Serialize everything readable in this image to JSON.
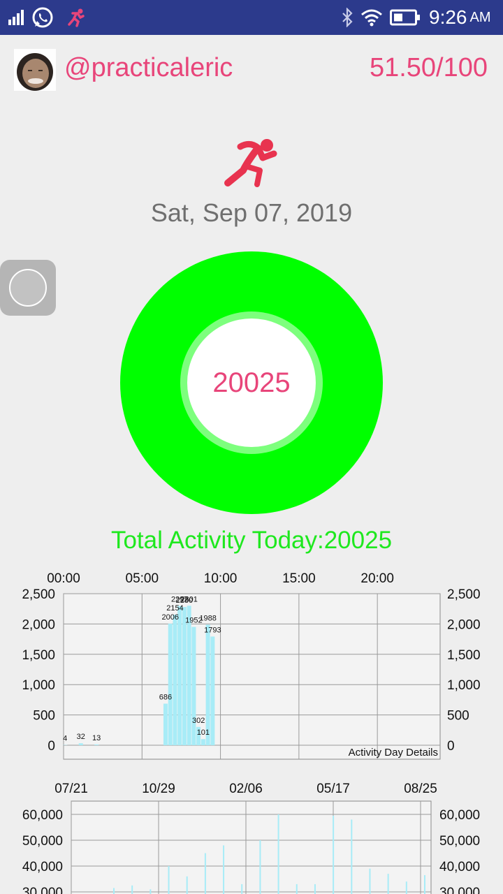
{
  "status_bar": {
    "time": "9:26",
    "ampm": "AM",
    "icons": [
      "signal-icon",
      "whatsapp-icon",
      "runner-notification-icon",
      "bluetooth-icon",
      "wifi-icon",
      "battery-icon"
    ]
  },
  "profile": {
    "username": "@practicaleric",
    "score": "51.50/100"
  },
  "activity": {
    "date": "Sat, Sep 07, 2019",
    "center_value": "20025",
    "total_label": "Total Activity Today:20025"
  },
  "colors": {
    "accent_pink": "#e8457a",
    "ring_green": "#00ff00",
    "text_green": "#1ee81e",
    "bar_blue": "#a8ecf7",
    "status_bar": "#2c3a8c"
  },
  "chart_data": [
    {
      "type": "bar",
      "title": "Activity Day Details",
      "x_tick_labels": [
        "00:00",
        "05:00",
        "10:00",
        "15:00",
        "20:00"
      ],
      "y_tick_labels": [
        "0",
        "500",
        "1,000",
        "1,500",
        "2,000",
        "2,500"
      ],
      "xlim": [
        0,
        24
      ],
      "ylim": [
        0,
        2500
      ],
      "grid": true,
      "x": [
        0.1,
        1.1,
        2.1,
        6.5,
        6.8,
        7.1,
        7.4,
        7.7,
        8.0,
        8.3,
        8.6,
        8.9,
        9.2,
        9.5
      ],
      "values": [
        4,
        32,
        13,
        686,
        2006,
        2154,
        2297,
        2280,
        2301,
        1952,
        302,
        101,
        1988,
        1793
      ],
      "labels": [
        "4",
        "32",
        "13",
        "686",
        "2006",
        "2154",
        "2297",
        "2280",
        "2301",
        "1952",
        "302",
        "101",
        "1988",
        "1793"
      ]
    },
    {
      "type": "bar",
      "x_tick_labels": [
        "07/21",
        "10/29",
        "02/06",
        "05/17",
        "08/25"
      ],
      "y_tick_labels": [
        "30,000",
        "40,000",
        "50,000",
        "60,000"
      ],
      "ylim": [
        30000,
        65000
      ],
      "grid": true,
      "values": [
        31500,
        32500,
        31000,
        40000,
        36000,
        45000,
        48000,
        33000,
        50000,
        60000,
        33000,
        33000,
        59500,
        58000,
        39000,
        37000,
        34000,
        36500
      ]
    }
  ]
}
